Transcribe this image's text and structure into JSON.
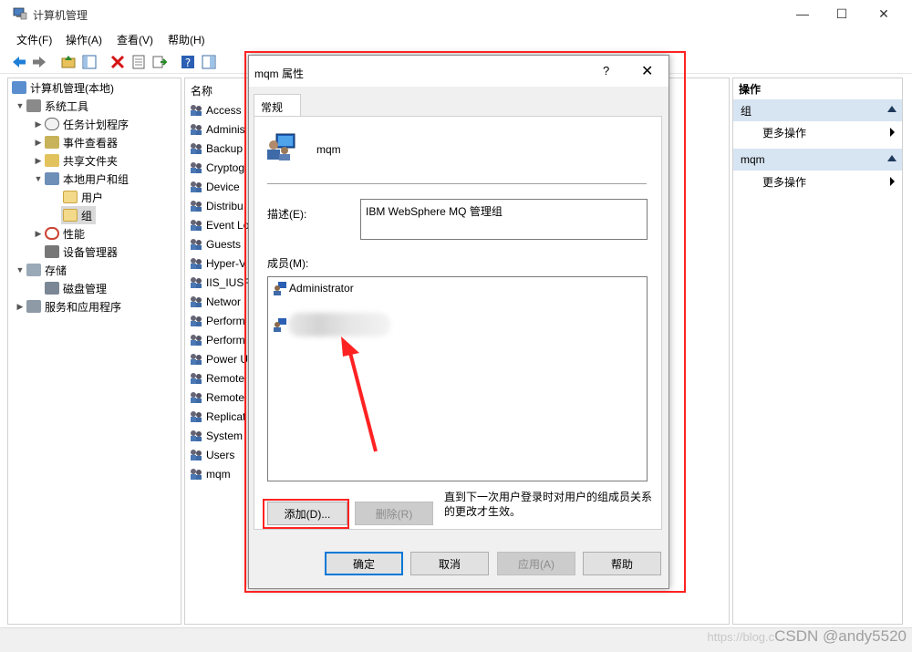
{
  "window": {
    "title": "计算机管理",
    "controls": {
      "minimize": "—",
      "maximize": "☐",
      "close": "✕"
    }
  },
  "menu": [
    "文件(F)",
    "操作(A)",
    "查看(V)",
    "帮助(H)"
  ],
  "tree": {
    "root": "计算机管理(本地)",
    "items": [
      {
        "label": "系统工具",
        "expanded": true
      },
      {
        "label": "任务计划程序"
      },
      {
        "label": "事件查看器"
      },
      {
        "label": "共享文件夹"
      },
      {
        "label": "本地用户和组",
        "expanded": true
      },
      {
        "label": "用户"
      },
      {
        "label": "组",
        "selected": true
      },
      {
        "label": "性能"
      },
      {
        "label": "设备管理器"
      },
      {
        "label": "存储",
        "expanded": true
      },
      {
        "label": "磁盘管理"
      },
      {
        "label": "服务和应用程序"
      }
    ]
  },
  "list": {
    "header": "名称",
    "items": [
      "Access",
      "Adminis",
      "Backup",
      "Cryptog",
      "Device",
      "Distribu",
      "Event Lo",
      "Guests",
      "Hyper-V",
      "IIS_IUSR",
      "Networ",
      "Perform",
      "Perform",
      "Power U",
      "Remote",
      "Remote",
      "Replicat",
      "System",
      "Users",
      "mqm"
    ]
  },
  "actions": {
    "header": "操作",
    "groups": [
      {
        "title": "组",
        "item": "更多操作"
      },
      {
        "title": "mqm",
        "item": "更多操作"
      }
    ]
  },
  "dialog": {
    "title": "mqm 属性",
    "help_glyph": "?",
    "close_glyph": "✕",
    "tab": "常规",
    "group_name": "mqm",
    "desc_label": "描述(E):",
    "desc_value": "IBM WebSphere MQ 管理组",
    "members_label": "成员(M):",
    "members": [
      "Administrator"
    ],
    "add_button": "添加(D)...",
    "remove_button": "删除(R)",
    "note": "直到下一次用户登录时对用户的组成员关系的更改才生效。",
    "ok_button": "确定",
    "cancel_button": "取消",
    "apply_button": "应用(A)",
    "help_button": "帮助"
  },
  "watermark": {
    "prefix": "https://blog.c",
    "brand": "CSDN @andy5520"
  },
  "colors": {
    "accent": "#0078d7",
    "annotation": "#ff2222",
    "actions_group_bg": "#d7e4f2"
  }
}
